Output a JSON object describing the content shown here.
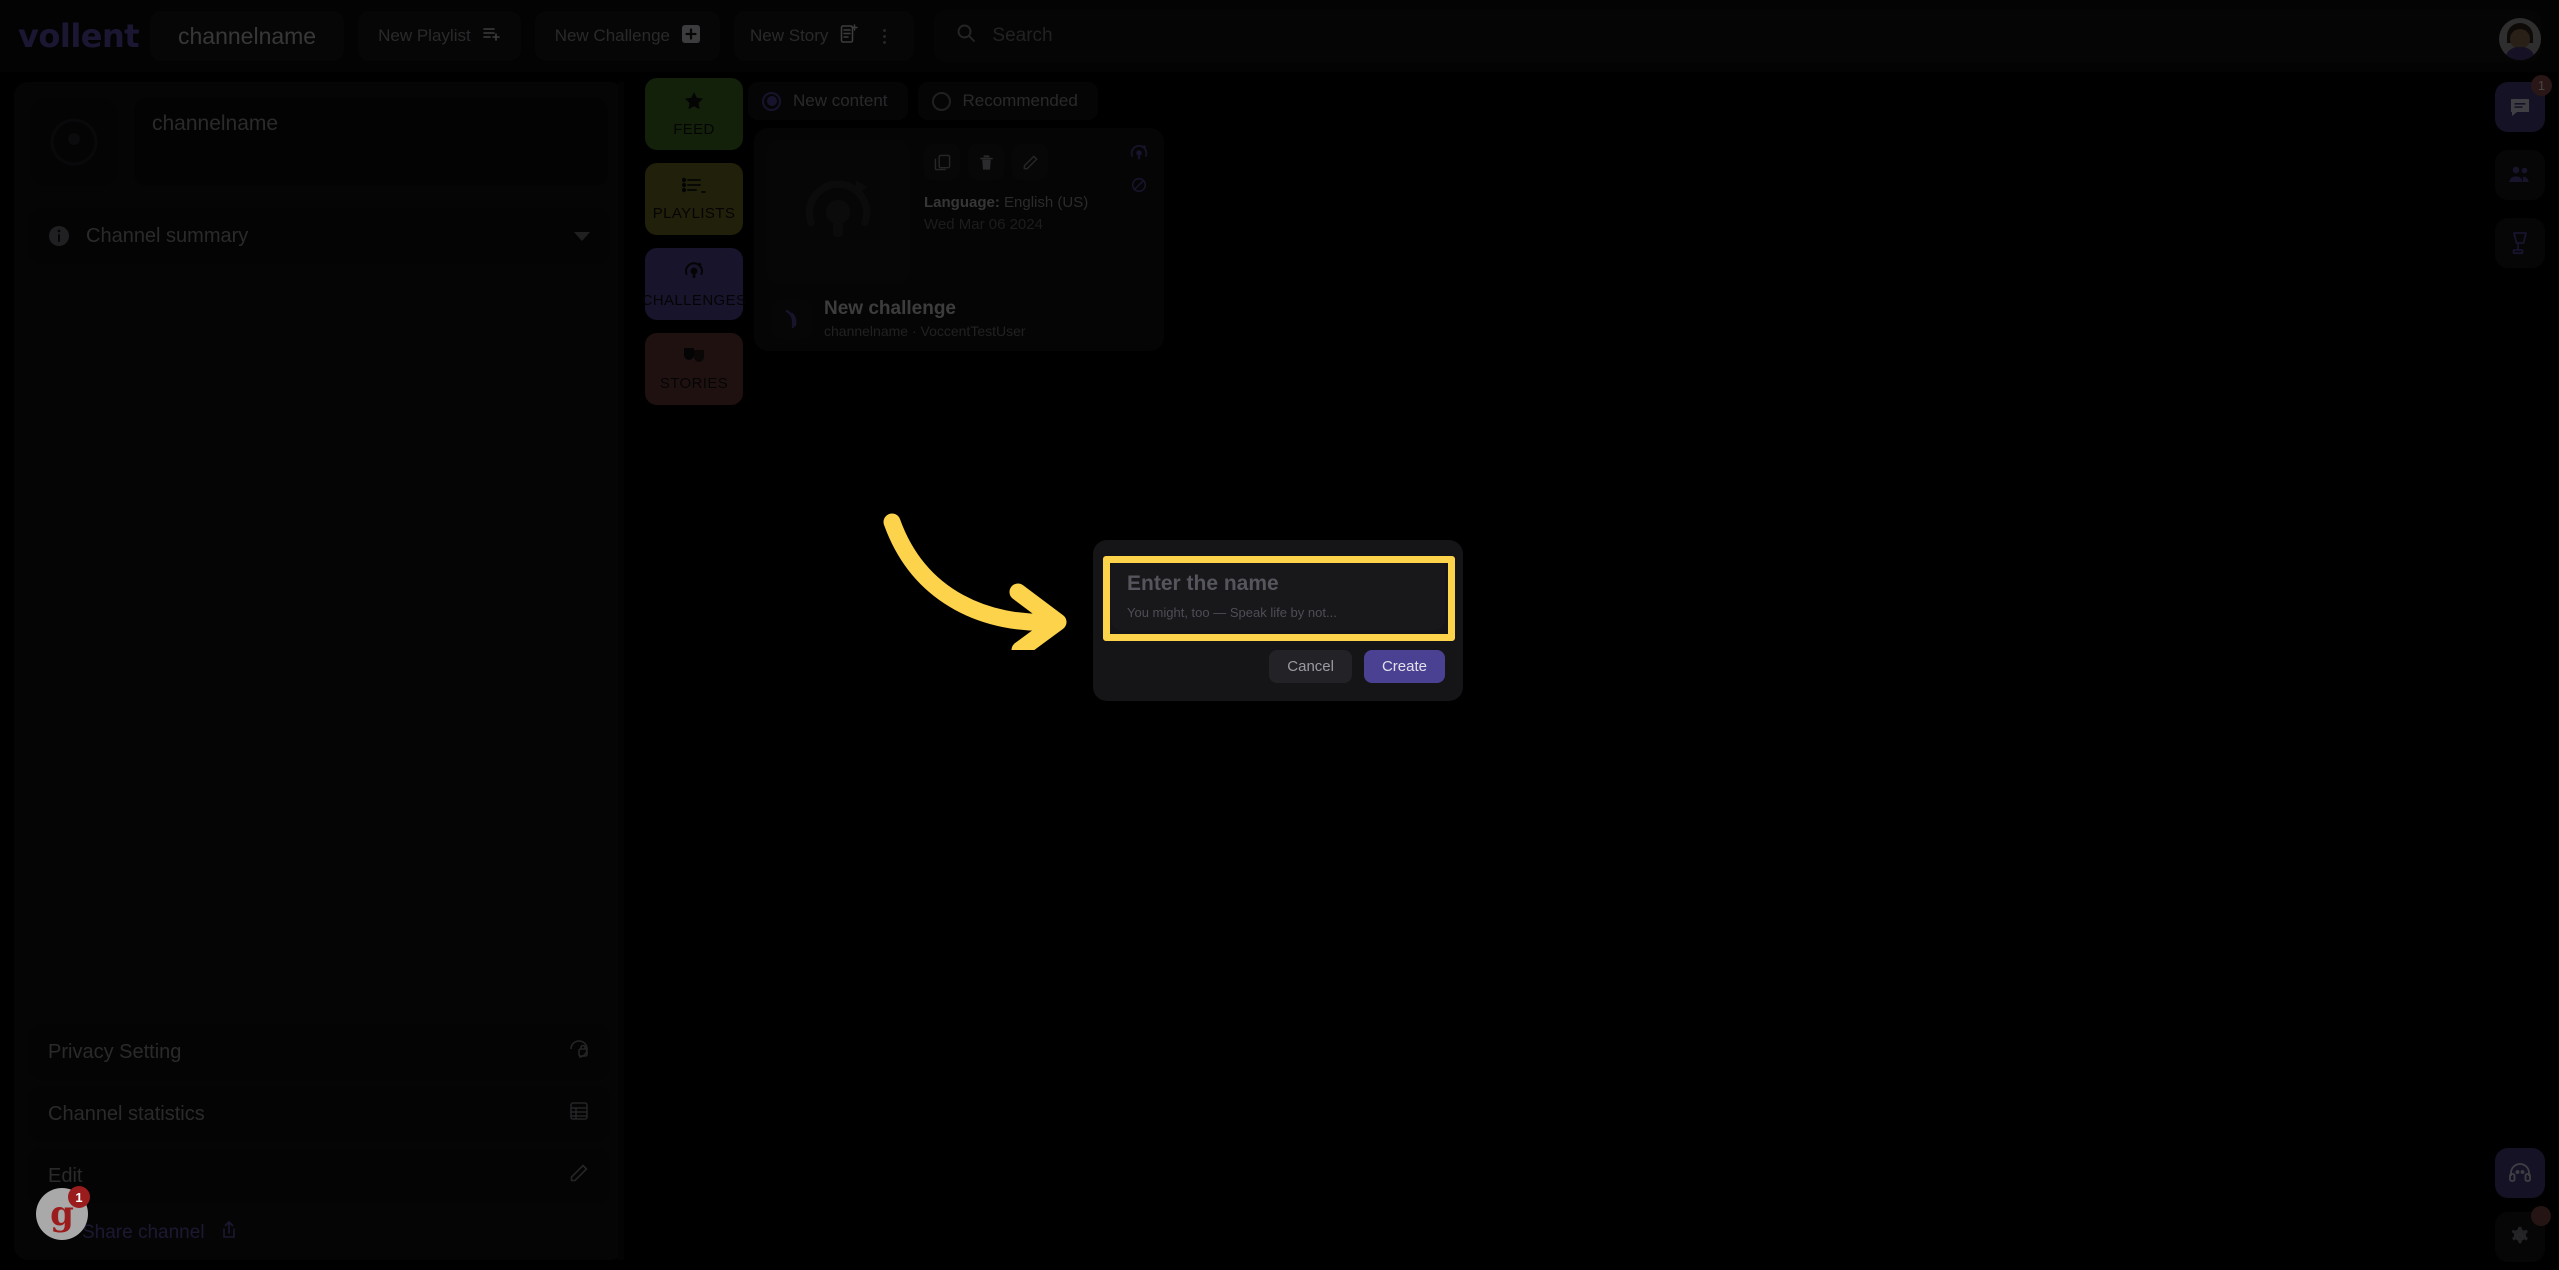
{
  "colors": {
    "accent": "#4b4193",
    "highlight": "#fcd34b",
    "feed_tab": "#3f6a22",
    "playlists_tab": "#6f6a21",
    "challenges_tab": "#4b4293",
    "stories_tab": "#6b3a3a",
    "page_background": "#000000"
  },
  "topbar": {
    "logo": "vollent",
    "channel_button": "channelname",
    "new_playlist": "New Playlist",
    "new_challenge": "New Challenge",
    "new_story": "New Story",
    "kebab_icon": "more-vertical-icon",
    "search_placeholder": "Search",
    "search_value": "",
    "search_icon": "search-icon",
    "avatar_icon": "user-avatar"
  },
  "sidebar": {
    "channel_avatar_icon": "channel-avatar-icon",
    "channel_name": "channelname",
    "summary_row": {
      "label": "Channel summary",
      "icon": "info-icon",
      "caret": "chevron-down-icon"
    },
    "bottom_rows": [
      {
        "label": "Privacy Setting",
        "icon": "privacy-lock-icon"
      },
      {
        "label": "Channel statistics",
        "icon": "statistics-icon"
      },
      {
        "label": "Edit",
        "icon": "pencil-icon"
      }
    ],
    "share": {
      "label": "Share channel",
      "left_icon": "share-nodes-icon",
      "right_icon": "share-upload-icon"
    }
  },
  "navtabs": [
    {
      "label": "FEED",
      "icon": "star-icon"
    },
    {
      "label": "PLAYLISTS",
      "icon": "list-icon"
    },
    {
      "label": "CHALLENGES",
      "icon": "challenge-bulb-icon"
    },
    {
      "label": "STORIES",
      "icon": "masks-icon"
    }
  ],
  "filters": [
    {
      "label": "New content",
      "selected": true
    },
    {
      "label": "Recommended",
      "selected": false
    }
  ],
  "card": {
    "thumbnail_icon": "challenge-bulb-icon",
    "actions": [
      {
        "icon": "copy-icon",
        "name": "duplicate"
      },
      {
        "icon": "trash-icon",
        "name": "delete"
      },
      {
        "icon": "pencil-icon",
        "name": "edit"
      }
    ],
    "corner_icons": [
      {
        "icon": "challenge-bulb-icon"
      },
      {
        "icon": "eye-off-icon"
      }
    ],
    "language_label": "Language:",
    "language_value": "English (US)",
    "date": "Wed Mar 06 2024",
    "title": "New challenge",
    "subtitle": "channelname · VoccentTestUser",
    "mini_logo_icon": "voccent-mark-icon"
  },
  "right_rail": {
    "top": [
      {
        "icon": "user-avatar",
        "name": "profile-avatar",
        "badge": null,
        "active": false
      },
      {
        "icon": "chat-icon",
        "name": "messages",
        "badge": "1",
        "active": true
      },
      {
        "icon": "people-icon",
        "name": "contacts",
        "badge": null,
        "active": false
      },
      {
        "icon": "blender-icon",
        "name": "mixer",
        "badge": null,
        "active": false
      }
    ],
    "bottom": [
      {
        "icon": "headset-icon",
        "name": "support",
        "badge": null,
        "active": true
      },
      {
        "icon": "gear-icon",
        "name": "settings",
        "badge": "",
        "active": false
      }
    ]
  },
  "modal": {
    "input_placeholder": "Enter the name",
    "input_value": "",
    "help_text": "You might, too — Speak life by not...",
    "cancel_label": "Cancel",
    "create_label": "Create"
  },
  "annotations": {
    "arrow": "curved-arrow-pointing-right",
    "highlight_target": "name-input-field"
  },
  "grammarly": {
    "mark": "g",
    "badge_count": "1"
  }
}
